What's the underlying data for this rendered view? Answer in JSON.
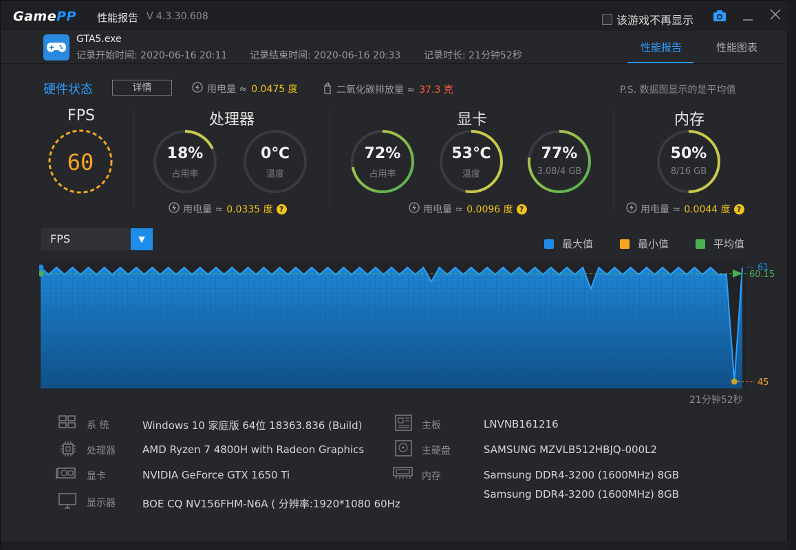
{
  "app": {
    "logo_game": "Game",
    "logo_pp": "PP",
    "title": "性能报告",
    "version": "V 4.3.30.608",
    "no_display_label": "该游戏不再显示"
  },
  "header": {
    "exe": "GTA5.exe",
    "start": "记录开始时间: 2020-06-16 20:11",
    "end": "记录结束时间: 2020-06-16 20:33",
    "duration": "记录时长: 21分钟52秒",
    "tabs": [
      {
        "label": "性能报告",
        "active": true
      },
      {
        "label": "性能图表",
        "active": false
      }
    ]
  },
  "hw": {
    "title": "硬件状态",
    "detail_label": "详情",
    "power_label": "用电量 ≈",
    "power_value": "0.0475 度",
    "co2_label": "二氧化碳排放量 ≈",
    "co2_value": "37.3 克",
    "ps": "P.S. 数据图显示的是平均值"
  },
  "fps": {
    "title": "FPS",
    "value": "60"
  },
  "cpu": {
    "title": "处理器",
    "usage": {
      "value": "18%",
      "sub": "占用率",
      "fraction": 0.18
    },
    "temp": {
      "value": "0℃",
      "sub": "温度",
      "fraction": 0.0
    },
    "power_label": "用电量 ≈",
    "power_value": "0.0335 度"
  },
  "gpu": {
    "title": "显卡",
    "usage": {
      "value": "72%",
      "sub": "占用率",
      "fraction": 0.72
    },
    "temp": {
      "value": "53℃",
      "sub": "温度",
      "fraction": 0.53
    },
    "mem": {
      "value": "77%",
      "sub": "3.08/4 GB",
      "fraction": 0.77
    },
    "power_label": "用电量 ≈",
    "power_value": "0.0096 度"
  },
  "ram": {
    "title": "内存",
    "usage": {
      "value": "50%",
      "sub": "8/16 GB",
      "fraction": 0.5
    },
    "power_label": "用电量 ≈",
    "power_value": "0.0044 度"
  },
  "chart_ctrl": {
    "selected": "FPS",
    "legend": [
      {
        "label": "最大值",
        "color": "#1e8ce8"
      },
      {
        "label": "最小值",
        "color": "#f5a623"
      },
      {
        "label": "平均值",
        "color": "#4caf50"
      }
    ],
    "duration_label": "21分钟52秒"
  },
  "chart_data": {
    "type": "area",
    "series_avg_label": "60.15",
    "max_label": "61",
    "min_label": "45",
    "ylim": [
      45,
      61
    ],
    "values": [
      61,
      60,
      61,
      60,
      61,
      60,
      61,
      60,
      61,
      60,
      61,
      60,
      61,
      60,
      61,
      60,
      61,
      60,
      61,
      60,
      61,
      60,
      61,
      60,
      61,
      60,
      61,
      60,
      61,
      60,
      61,
      60,
      61,
      60,
      61,
      60,
      61,
      60,
      61,
      60,
      61,
      60,
      61,
      60,
      61,
      60,
      61,
      60,
      61,
      59,
      61,
      60,
      61,
      60,
      61,
      60,
      61,
      60,
      61,
      60,
      61,
      60,
      61,
      60,
      61,
      60,
      61,
      60,
      61,
      58,
      61,
      60,
      61,
      60,
      61,
      60,
      61,
      60,
      61,
      60,
      61,
      60,
      61,
      60,
      61,
      60,
      60,
      45,
      61
    ]
  },
  "sysinfo": {
    "left": [
      {
        "label": "系  统",
        "value": "Windows 10 家庭版 64位   18363.836 (Build)"
      },
      {
        "label": "处理器",
        "value": "AMD Ryzen 7 4800H with Radeon Graphics"
      },
      {
        "label": "显卡",
        "value": "NVIDIA GeForce GTX 1650 Ti"
      },
      {
        "label": "显示器",
        "value": "BOE CQ NV156FHM-N6A ( 分辨率:1920*1080 60Hz"
      }
    ],
    "right": [
      {
        "label": "主板",
        "value": "LNVNB161216"
      },
      {
        "label": "主硬盘",
        "value": "SAMSUNG MZVLB512HBJQ-000L2"
      },
      {
        "label": "内存",
        "value": "Samsung DDR4-3200 (1600MHz) 8GB"
      },
      {
        "label": "",
        "value": "Samsung DDR4-3200 (1600MHz) 8GB"
      }
    ]
  },
  "colors": {
    "accent": "#2e9bff",
    "gauge_fill": "#c7c94a",
    "gauge_green": "#4caf50",
    "gauge_track": "#3a3b40",
    "fps_ring": "#f5a623"
  }
}
